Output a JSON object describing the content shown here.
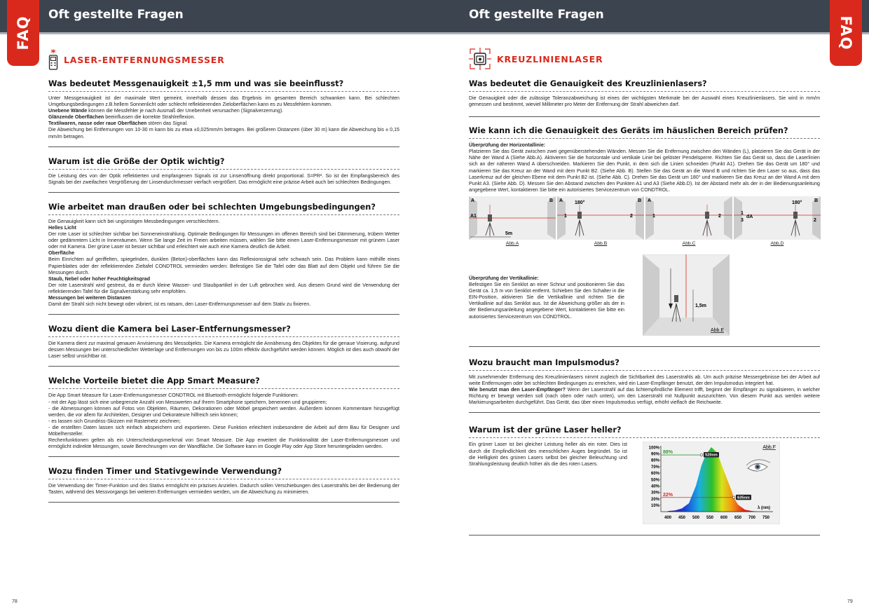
{
  "left": {
    "page_title": "Oft gestellte Fragen",
    "faq_label": "FAQ",
    "category_title": "LASER-ENTFERNUNGSMESSER",
    "page_number": "78",
    "sections": [
      {
        "title": "Was bedeutet Messgenauigkeit ±1,5 mm und was sie beeinflusst?",
        "lines": [
          {
            "text": "Unter Messgenauigkeit ist der maximale Wert gemeint, innerhalb dessen das Ergebnis im gesamten Bereich schwanken kann. Bei schlechten Umgebungsbedingungen z.B.hellem Sonnenlicht oder schlecht reflektierenden Zieloberflächen kann es zu Messfehlern kommen."
          },
          {
            "bold": "Unebene Wände",
            "text": " können die Messfehler je nach Ausmaß der Unebenheit verursachen (Signalverzerrung)."
          },
          {
            "bold": "Glänzende Oberflächen",
            "text": " beeinflussen die korrekte Strahlreflexion."
          },
          {
            "bold": "Textilwaren, nasse oder raue Oberflächen",
            "text": " stören das Signal."
          },
          {
            "text": "Die Abweichung bei Entfernungen von 10-30 m kann bis zu etwa ±0,025mm/m betragen. Bei größeren Distanzen (über 30 m) kann die Abweichung bis ± 0,15 mm/m betragen."
          }
        ]
      },
      {
        "title": "Warum ist die Größe der Optik wichtig?",
        "lines": [
          {
            "text": "Die Leistung des von der Optik reflektierten und empfangenen Signals ist zur Linsenöffnung direkt proportional. S=PR². So ist der Empfangsbereich des Signals bei der zweifachen Vergrößerung der Linsendurchmesser vierfach vergrößert. Das ermöglicht eine präzise Arbeit auch bei schlechten Bedingungen."
          }
        ]
      },
      {
        "title": "Wie arbeitet man draußen oder bei schlechten Umgebungsbedingungen?",
        "lines": [
          {
            "text": "Die Genauigkeit kann sich bei ungünstigen Messbedingungen verschlechtern."
          },
          {
            "bold": "Helles Licht",
            "text": ""
          },
          {
            "text": "Der rote Laser ist schlechter sichtbar bei Sonneneinstrahlung. Optimale Bedingungen für Messungen im offenen Bereich sind bei Dämmerung, trübem Wetter oder gedämmtem Licht in Innenräumen. Wenn Sie lange Zeit im Freien arbeiten müssen, wählen Sie bitte einen Laser-Entfernungsmesser mit grünem Laser oder mit Kamera. Der grüne Laser ist besser sichtbar und erleichtert wie auch eine Kamera deutlich die Arbeit."
          },
          {
            "bold": "Oberfläche",
            "text": ""
          },
          {
            "text": "Beim Einrichten auf geriffelten, spiegelnden, dunklen (Beton)-oberflächen kann das Reflexionssignal sehr schwach sein. Das Problem kann mithilfe eines Papierblattes oder der reflektierenden Zieltafel CONDTROL vermieden werden: Befestigen Sie die Tafel oder das Blatt auf dem Objekt und führen Sie die Messungen durch."
          },
          {
            "bold": "Staub, Nebel oder hoher Feuchtigkeitsgrad",
            "text": ""
          },
          {
            "text": "Der rote Laserstrahl wird gestreut, da er durch kleine Wasser- und Staubpartikel in der Luft gebrochen wird. Aus diesem Grund wird die Verwendung der reflektierenden Tafel für die Signalverstärkung sehr empfohlen."
          },
          {
            "bold": "Messungen bei weiteren Distanzen",
            "text": ""
          },
          {
            "text": "Damit der Strahl sich nicht bewegt oder vibriert, ist es ratsam, den Laser-Entfernungsmesser auf dem Stativ zu fixieren."
          }
        ]
      },
      {
        "title": "Wozu dient die Kamera bei Laser-Entfernungsmesser?",
        "lines": [
          {
            "text": "Die Kamera dient zur maximal genauen Anvisierung des Messobjekts. Die Kamera ermöglicht die Annäherung des Objektes für die genaue Visierung, aufgrund dessen Messungen bei unterschiedlicher Wetterlage und Entfernungen von bis zu 100m effektiv durchgeführt werden können. Möglich ist dies auch obwohl der Laser selbst unsichtbar ist."
          }
        ]
      },
      {
        "title": "Welche Vorteile bietet die App Smart Measure?",
        "lines": [
          {
            "text": "Die App Smart Measure für Laser-Entfernungsmesser CONDTROL mit Bluetooth ermöglicht folgende Funktionen:"
          },
          {
            "text": "- mit der App lässt sich eine unbegrenzte Anzahl von Messwerten auf Ihrem Smartphone speichern, benennen und gruppieren;"
          },
          {
            "text": "- die Abmessungen können auf Fotos von Objekten, Räumen, Dekorationen oder Möbel gespeichert werden. Außerdem können Kommentare hinzugefügt werden, die vor allem für Architekten, Designer und Dekorateure hilfreich sein können;"
          },
          {
            "text": " - es lassen sich Grundriss-Skizzen mit Rasternetz zeichnen;"
          },
          {
            "text": "- die erstellten Daten lassen sich einfach abspeichern und exportieren. Diese Funktion erleichtert insbesondere die Arbeit auf dem Bau für Designer und Möbelhersteller."
          },
          {
            "text": "Rechenfunktionen gelten als ein Unterscheidungsmerkmal von Smart Measure. Die App erweitert die Funktionalität der Laser-Entfernungsmesser und ermöglicht indirekte Messungen, sowie Berechnungen von der Wandfläche. Die Software kann im Google Play oder App Store heruntergeladen werden."
          }
        ]
      },
      {
        "title": "Wozu finden Timer und Stativgewinde Verwendung?",
        "lines": [
          {
            "text": "Die Verwendung der Timer-Funktion und des Stativs ermöglicht ein präzises Anzielen. Dadurch sollen Verschiebungen des Laserstrahls bei der Bedienung der Tasten, während des Messvorgangs bei weiteren Entfernungen vermieden werden, um die Abweichung zu minimieren."
          }
        ]
      }
    ]
  },
  "right": {
    "page_title": "Oft gestellte Fragen",
    "faq_label": "FAQ",
    "category_title": "KREUZLINIENLASER",
    "page_number": "79",
    "sec1": {
      "title": "Was bedeutet die Genauigkeit des Kreuzlinienlasers?",
      "text": "Die Genauigkeit oder die zulässige Toleranzabweichung ist eines der wichtigsten Merkmale bei der Auswahl eines Kreuzlinienlasers. Sie wird in mm/m gemessen und bestimmt, wieviel Millimeter pro Meter der Entfernung der Strahl abweichen darf."
    },
    "sec2": {
      "title": "Wie kann ich die Genauigkeit des Geräts im häuslichen Bereich prüfen?",
      "sub1": "Überprüfung der Horizontallinie:",
      "text1": "Platzieren Sie das Gerät zwischen zwei gegenüberstehenden Wänden. Messen Sie die Entfernung zwischen den Wänden (L), platzieren Sie das Gerät in der Nähe der Wand A (Siehe Abb.A). Aktivieren Sie die horizontale und vertikale Linie bei gelöster Pendelsperre. Richten Sie das Gerät so, dass die Laserlinien sich an der näheren Wand A überschneiden. Markieren Sie den Punkt, in dem sich die Linien schneiden (Punkt A1). Drehen Sie das Gerät um 180° und markieren Sie das Kreuz an der Wand mit dem Punkt B2. (Siehe Abb. B). Stellen Sie das Gerät an die Wand B und richten Sie den Laser so aus, dass das Laserkreuz auf der gleichen Ebene mit dem Punkt B2 ist. (Siehe Abb. C). Drehen Sie das Gerät um 180° und markieren Sie das Kreuz an der Wand A mit dem Punkt A3. (Siehe Abb. D). Messen Sie den Abstand zwischen den Punkten A1 und A3 (Siehe Abb.D). Ist der Abstand mehr als der in der Bedienungsanleitung angegebene Wert, kontaktieren Sie bitte ein autorisiertes Servicezentrum von CONDTROL.",
      "fig_b_top": "B",
      "figures": [
        {
          "caption": "Abb.A",
          "left": "A",
          "right": "B",
          "p1": "A1",
          "p2": "",
          "extra": "5m"
        },
        {
          "caption": "Abb.B",
          "left": "A",
          "right": "B",
          "p1": "1",
          "p2": "2",
          "extra": "180°"
        },
        {
          "caption": "Abb.C",
          "left": "A",
          "right": "",
          "p1": "1",
          "p2": "2",
          "extra": ""
        },
        {
          "caption": "Abb.D",
          "left": "",
          "right": "B",
          "p1": "1",
          "p2": "2",
          "extra": "180°"
        }
      ],
      "fig_d_da": "dA",
      "fig_d_3": "3",
      "sub2": "Überprüfung der Vertikallinie:",
      "text2": "Befestigen Sie ein Senklot an einer Schnur und positionieren Sie das Gerät ca. 1,5 m von Senklot entfernt. Schieben Sie den Schalter in die EIN-Position, aktivieren Sie die Vertikallinie und richten Sie die Vertikallinie auf das Senklot aus. Ist die Abweichung größer als der in der Bedienungsanleitung angegebene Wert, kontaktieren Sie bitte ein autorisiertes Servicezentrum von CONDTROL.",
      "fig_e_caption": "Abb.E",
      "fig_e_label": "1,5m"
    },
    "sec3": {
      "title": "Wozu braucht man Impulsmodus?",
      "text1": "Mit zunehmender Entfernung des Kreuzlinienlasers nimmt zugleich die Sichtbarkeit des Laserstrahls ab. Um auch präzise Messergebnisse bei der Arbeit auf weite Entfernungen oder bei schlechten Bedingungen zu erreichen, wird ein Laser-Empfänger benutzt, der den Impulsmodus integriert hat.",
      "bold": "Wie benutzt man den Laser-Empfänger?",
      "text2": " Wenn der Laserstrahl auf das lichtempfindliche Element trifft, beginnt der Empfänger zu signalisieren, in welcher Richtung er bewegt werden soll (nach oben oder nach unten), um den Laserstrahl mit Nullpunkt auszurichten. Von diesem Punkt aus werden weitere Markierungsarbeiten durchgeführt. Das Gerät, das über einen Impulsmodus verfügt, erhöht vielfach die Reichweite."
    },
    "sec4": {
      "title": "Warum ist der grüne Laser heller?",
      "text": "Ein grüner Laser ist bei gleicher Leistung heller als ein roter. Dies ist durch die Empfindlichkeit des menschlichen Auges begründet. So ist die Helligkeit des grünen Lasers selbst bei gleicher Beleuchtung und Strahlungsleistung deutlich höher als die des roten Lasers."
    }
  },
  "chart_data": {
    "type": "area",
    "caption": "Abb.F",
    "x_ticks": [
      "400",
      "450",
      "500",
      "550",
      "600",
      "650",
      "700",
      "750"
    ],
    "y_ticks": [
      "100%",
      "90%",
      "80%",
      "70%",
      "60%",
      "50%",
      "40%",
      "30%",
      "20%",
      "10%"
    ],
    "xlabel": "λ (nm)",
    "xlim": [
      375,
      775
    ],
    "ylim": [
      0,
      100
    ],
    "x": [
      400,
      425,
      450,
      475,
      500,
      520,
      535,
      555,
      575,
      600,
      625,
      635,
      650,
      675,
      700,
      725,
      750
    ],
    "y": [
      1,
      2,
      5,
      13,
      40,
      72,
      88,
      100,
      92,
      63,
      35,
      22,
      11,
      3,
      1,
      0,
      0
    ],
    "annotations": [
      {
        "x": 520,
        "y": 88,
        "label": "520nm",
        "value_label": "88%",
        "color": "#3a9a3a"
      },
      {
        "x": 635,
        "y": 22,
        "label": "635nm",
        "value_label": "22%",
        "color": "#d9291c"
      }
    ]
  }
}
